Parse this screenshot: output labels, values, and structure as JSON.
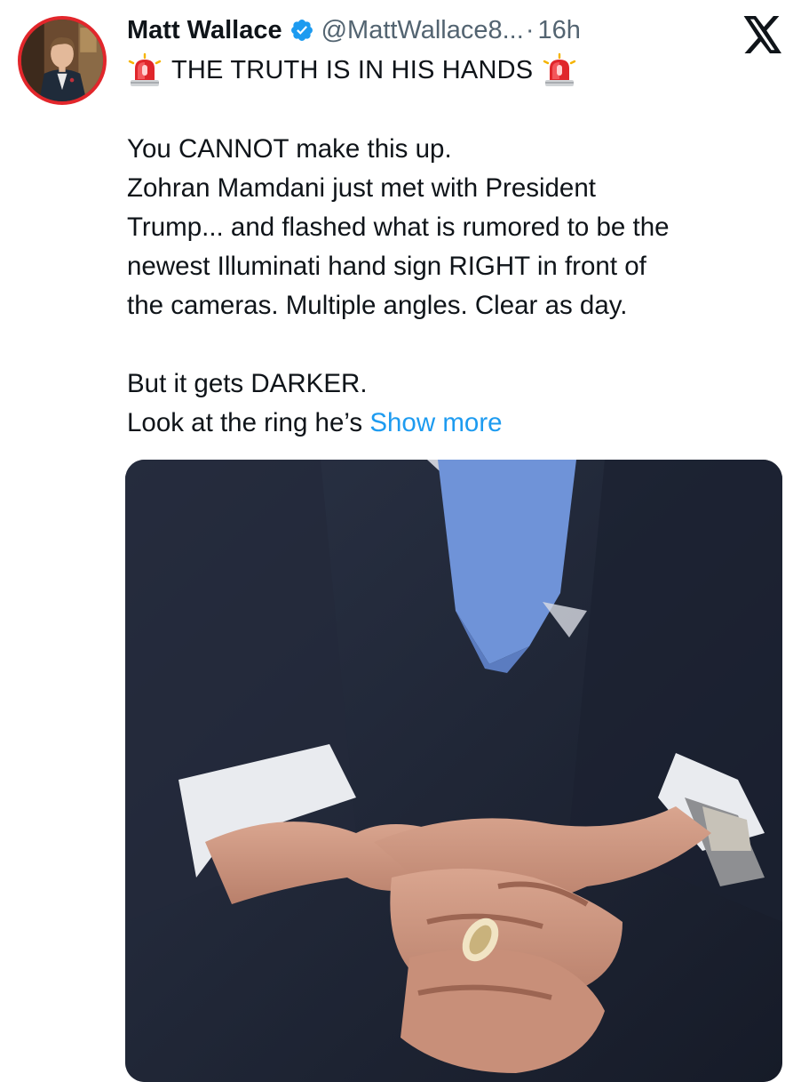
{
  "tweet": {
    "author_name": "Matt Wallace",
    "author_handle": "@MattWallace8...",
    "separator": "·",
    "timestamp": "16h",
    "headline": "THE TRUTH IS IN HIS HANDS",
    "body_lines": [
      "You CANNOT make this up.",
      "Zohran Mamdani just met with President",
      "Trump... and flashed what is rumored to be the",
      "newest Illuminati hand sign RIGHT in front of",
      "the cameras. Multiple angles. Clear as day."
    ],
    "body_lines_2": [
      "But it gets DARKER."
    ],
    "last_line_prefix": "Look at the ring he’s ",
    "show_more_label": "Show more"
  },
  "icons": {
    "verified": "verified-badge-icon",
    "siren": "police-siren-emoji-icon",
    "platform": "x-logo-icon"
  },
  "colors": {
    "link": "#1d9bf0",
    "verified": "#1d9bf0",
    "muted": "#536471",
    "avatar_ring": "#e2262b",
    "siren_red": "#e0262b"
  }
}
